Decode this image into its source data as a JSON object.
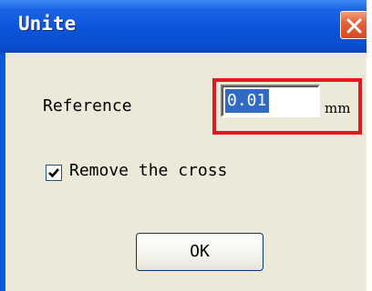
{
  "window": {
    "title": "Unite",
    "close_icon": "close-icon"
  },
  "reference": {
    "label": "Reference",
    "value": "0.01",
    "unit": "mm"
  },
  "remove_cross": {
    "label": "Remove the cross",
    "checked": true
  },
  "buttons": {
    "ok_label": "OK"
  },
  "colors": {
    "titlebar": "#0b54d8",
    "dialog_background": "#ece9d8",
    "highlight": "#e8141e",
    "selection": "#316ac5",
    "close_button": "#d64a22"
  }
}
